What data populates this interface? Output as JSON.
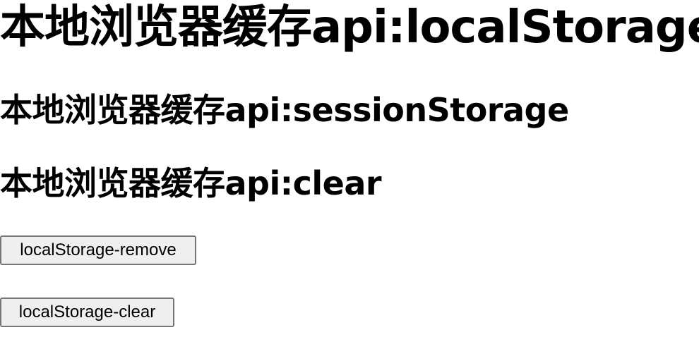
{
  "headings": {
    "local_storage": "本地浏览器缓存api:localStorage",
    "session_storage": "本地浏览器缓存api:sessionStorage",
    "clear": "本地浏览器缓存api:clear"
  },
  "buttons": {
    "remove_label": "localStorage-remove",
    "clear_label": "localStorage-clear"
  }
}
